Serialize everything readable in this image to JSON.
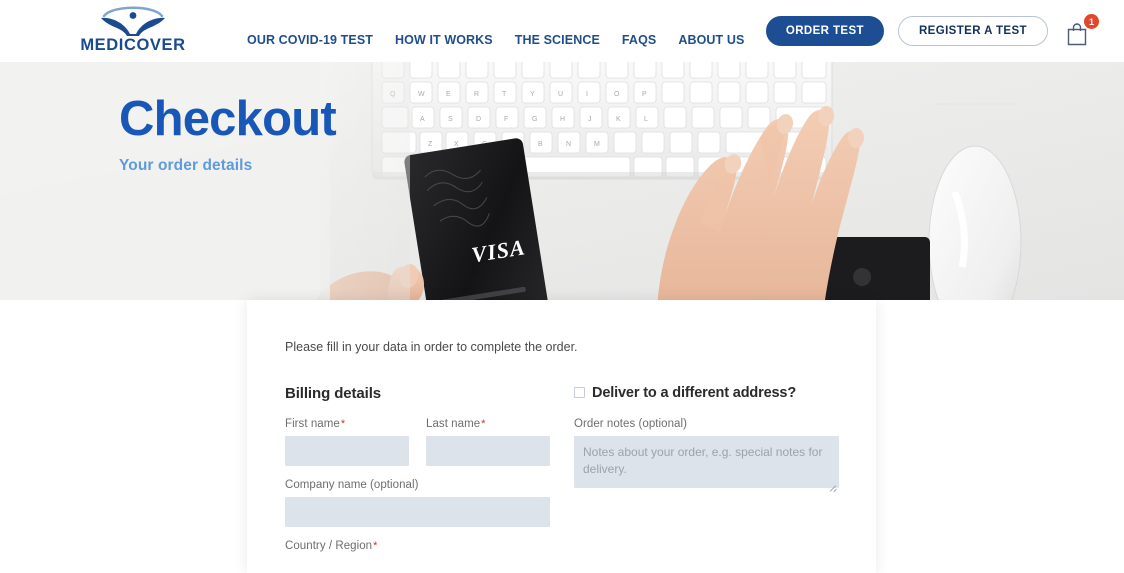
{
  "brand": {
    "name": "MEDICOVER",
    "logo_icon": "medicover-figure-logo",
    "primary_color": "#1d4e94",
    "accent_color": "#1857b8",
    "badge_color": "#e0472c"
  },
  "nav": {
    "items": [
      {
        "label": "OUR COVID-19 TEST"
      },
      {
        "label": "HOW IT WORKS"
      },
      {
        "label": "THE SCIENCE"
      },
      {
        "label": "FAQS"
      },
      {
        "label": "ABOUT US"
      }
    ]
  },
  "header_actions": {
    "order_test_label": "ORDER TEST",
    "register_test_label": "REGISTER A TEST",
    "cart_icon": "shopping-bag-icon",
    "cart_count": "1"
  },
  "hero": {
    "title": "Checkout",
    "subtitle": "Your order details"
  },
  "checkout": {
    "intro": "Please fill in your data in order to complete the order.",
    "billing_title": "Billing details",
    "fields": {
      "first_name": {
        "label": "First name",
        "required": "*",
        "value": ""
      },
      "last_name": {
        "label": "Last name",
        "required": "*",
        "value": ""
      },
      "company_name": {
        "label": "Company name (optional)",
        "value": ""
      },
      "country_region": {
        "label": "Country / Region",
        "required": "*"
      }
    },
    "shipping": {
      "different_address_label": "Deliver to a different address?",
      "checkbox_checked": "false",
      "order_notes_label": "Order notes (optional)",
      "order_notes_placeholder": "Notes about your order, e.g. special notes for delivery.",
      "order_notes_value": ""
    }
  }
}
